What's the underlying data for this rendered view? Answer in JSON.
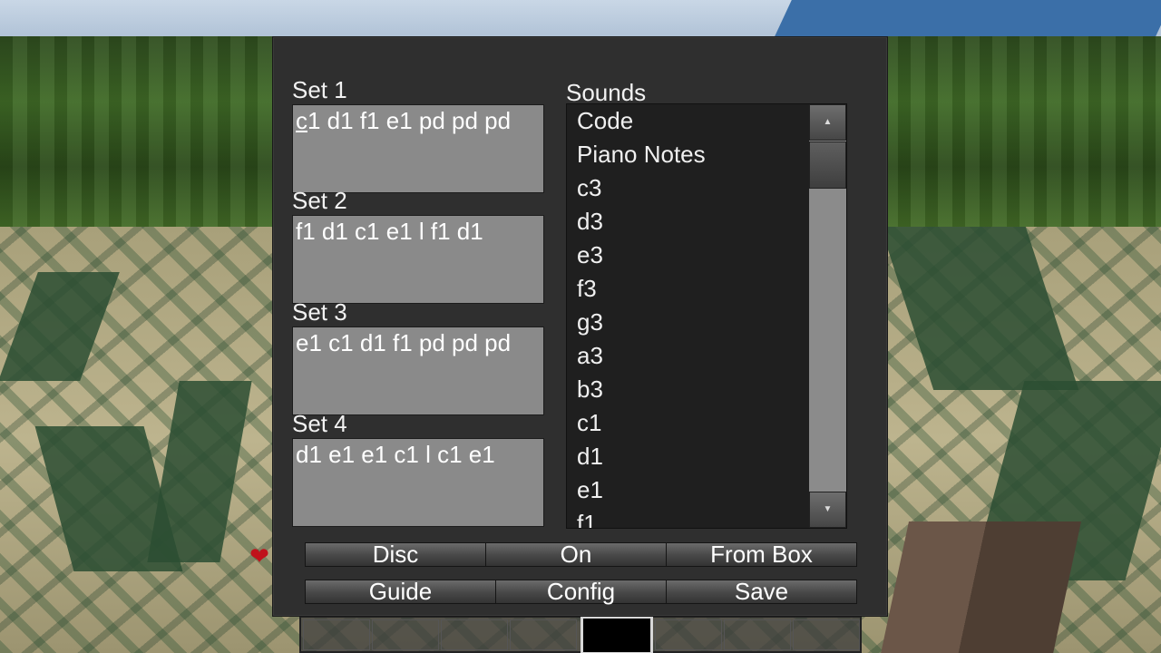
{
  "dialog": {
    "sets": [
      {
        "label": "Set 1",
        "value_cursor_char": "c",
        "value_rest": "1 d1 f1 e1 pd pd pd"
      },
      {
        "label": "Set 2",
        "value": "f1 d1 c1 e1 l f1 d1"
      },
      {
        "label": "Set 3",
        "value": "e1 c1 d1 f1 pd pd pd"
      },
      {
        "label": "Set 4",
        "value": "d1 e1 e1 c1 l c1 e1"
      }
    ],
    "sounds": {
      "label": "Sounds",
      "items": [
        "Code",
        "Piano Notes",
        "c3",
        "d3",
        "e3",
        "f3",
        "g3",
        "a3",
        "b3",
        "c1",
        "d1",
        "e1",
        "f1"
      ],
      "scroll_up_icon": "triangle-up-icon",
      "scroll_down_icon": "triangle-down-icon"
    },
    "buttons_row1": {
      "disc": "Disc",
      "on": "On",
      "from_box": "From Box"
    },
    "buttons_row2": {
      "guide": "Guide",
      "config": "Config",
      "save": "Save"
    }
  },
  "hud": {
    "health_icon": "heart-icon"
  }
}
